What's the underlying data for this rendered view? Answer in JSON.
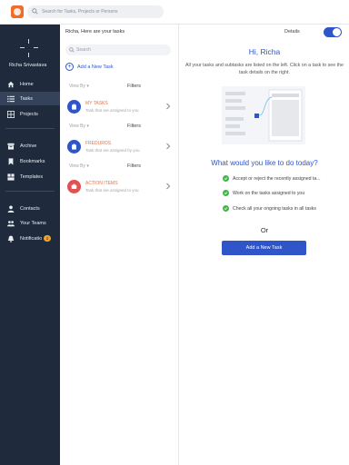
{
  "top": {
    "search_placeholder": "Search for Tasks, Projects or Persons"
  },
  "sidebar": {
    "user_name": "Richa Srivastava",
    "items": [
      {
        "label": "Home",
        "icon": "home-icon"
      },
      {
        "label": "Tasks",
        "icon": "list-icon"
      },
      {
        "label": "Projects",
        "icon": "grid-icon"
      },
      {
        "label": "Archive",
        "icon": "archive-icon"
      },
      {
        "label": "Bookmarks",
        "icon": "bookmark-icon"
      },
      {
        "label": "Templates",
        "icon": "template-icon"
      },
      {
        "label": "Contacts",
        "icon": "person-icon"
      },
      {
        "label": "Your Teams",
        "icon": "team-icon"
      },
      {
        "label": "Notificatio",
        "icon": "bell-icon",
        "badge": "2"
      }
    ]
  },
  "middle": {
    "greeting": "Richa, Here are your tasks",
    "search_placeholder": "Search",
    "add_task": "Add a New Task",
    "view_by": "View By",
    "filters": "Filters",
    "tasks": [
      {
        "title": "MY TASKS",
        "subtitle": "Task that are assigned to you",
        "color": "#2f55c9",
        "title_color": "#e0734a"
      },
      {
        "title": "FREDUROS",
        "subtitle": "Task that are assigned by you",
        "color": "#2f55c9",
        "title_color": "#e0734a"
      },
      {
        "title": "ACTION ITEMS",
        "subtitle": "Task that are assigned to you",
        "color": "#e05252",
        "title_color": "#e0734a"
      }
    ]
  },
  "right": {
    "details": "Details",
    "greeting": "Hi, Richa",
    "intro": "All your tasks and subtasks are listed on the left. Click on a task to see the task details on the right.",
    "question": "What would you like to do today?",
    "options": [
      "Accept or reject the recently assigned ta...",
      "Work on the tasks assigned to you",
      "Check all your ongoing tasks in all tasks"
    ],
    "or": "Or",
    "cta": "Add a New Task"
  },
  "colors": {
    "accent": "#2f55c9",
    "sidebar": "#1f2a3c",
    "success": "#43b649",
    "orange": "#ef6c2a"
  }
}
